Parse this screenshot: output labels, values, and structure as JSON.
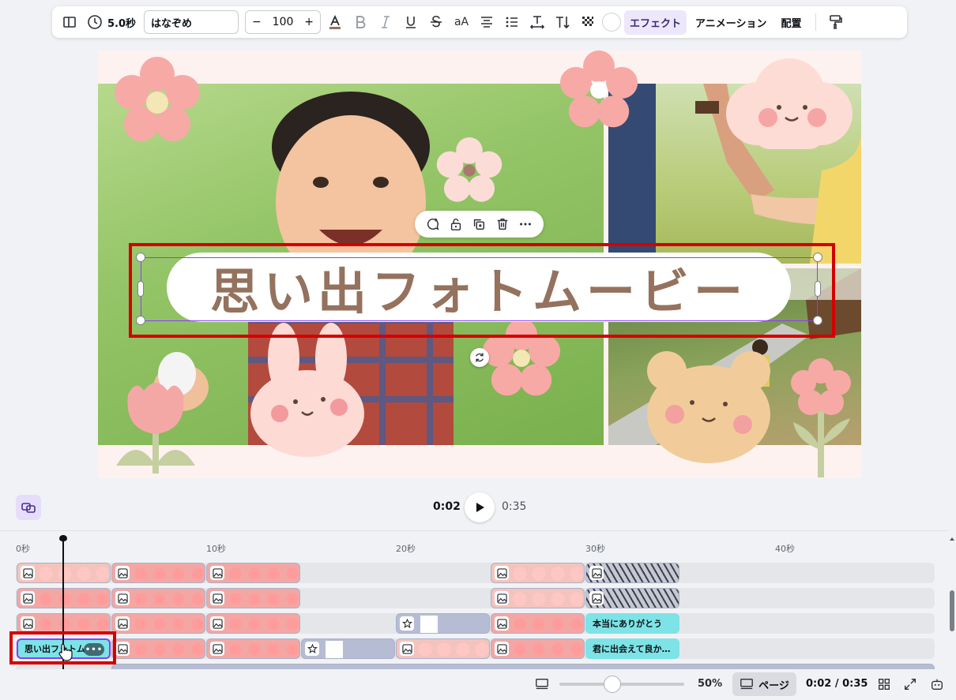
{
  "toolbar": {
    "duration": "5.0秒",
    "font_name": "はなぞめ",
    "font_size": "100",
    "minus": "−",
    "plus": "+",
    "case_label": "aA",
    "effects_label": "エフェクト",
    "animation_label": "アニメーション",
    "position_label": "配置"
  },
  "canvas": {
    "title": "思い出フォトムービー"
  },
  "playback": {
    "current": "0:02",
    "total": "0:35"
  },
  "timeline": {
    "ruler": [
      "0秒",
      "10秒",
      "20秒",
      "30秒",
      "40秒"
    ],
    "text_clip_1": "本当にありがとう",
    "text_clip_2": "君に出会えて良か…",
    "text_clip_selected": "思い出フォトム…",
    "more_dots": "•••"
  },
  "bottom": {
    "zoom": "50%",
    "page_label": "ページ",
    "page_count": "0:02 / 0:35"
  },
  "colors": {
    "accent": "#8b3dff",
    "title_brown": "#94725e",
    "highlight_red": "#d40000",
    "text_clip_cyan": "#7de3e6"
  }
}
